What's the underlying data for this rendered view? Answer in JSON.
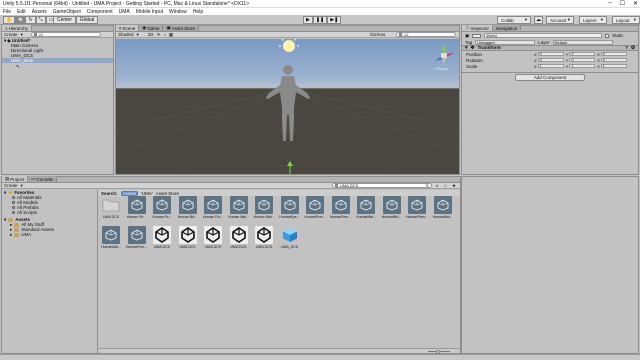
{
  "window": {
    "title": "Unity 5.5.1f1 Personal (64bit) - Untitled - UMA Project - Getting Started - PC, Mac & Linux Standalone* <DX11>",
    "menus": [
      "File",
      "Edit",
      "Assets",
      "GameObject",
      "Component",
      "UMA",
      "Mobile Input",
      "Window",
      "Help"
    ]
  },
  "toolbar": {
    "pivot": "Center",
    "space": "Global",
    "collab": "Collab",
    "account": "Account",
    "layers": "Layers",
    "layout": "Layout"
  },
  "hierarchy": {
    "tab": "Hierarchy",
    "create": "Create",
    "search": "All",
    "scene": "Untitled*",
    "items": [
      "Main Camera",
      "Directional Light",
      "UMA_DCS",
      "UMA_Male"
    ]
  },
  "scene": {
    "tabs": [
      "Scene",
      "Game",
      "Asset Store"
    ],
    "shading": "Shaded",
    "gizmos": "Gizmos",
    "search": "All",
    "persp": "< Persp"
  },
  "inspector": {
    "tabs": [
      "Inspector",
      "Navigation"
    ],
    "object_name": "World",
    "static_label": "Static",
    "tag_label": "Tag",
    "tag_value": "Untagged",
    "layer_label": "Layer",
    "layer_value": "Default",
    "component": "Transform",
    "rows": [
      {
        "label": "Position",
        "x": "0",
        "y": "0",
        "z": "0"
      },
      {
        "label": "Rotation",
        "x": "0",
        "y": "0",
        "z": "0"
      },
      {
        "label": "Scale",
        "x": "1",
        "y": "1",
        "z": "1"
      }
    ],
    "add_component": "Add Component"
  },
  "project": {
    "tabs": [
      "Project",
      "Console"
    ],
    "create": "Create",
    "favorites_title": "Favorites",
    "favorites": [
      "All Materials",
      "All Models",
      "All Prefabs",
      "All Scripts"
    ],
    "assets_title": "Assets",
    "assets_tree": [
      "All My Stuff",
      "Standard Assets",
      "UMA"
    ],
    "search_label": "Search:",
    "search_scopes": [
      "Assets",
      "'UMA'",
      "Asset Store"
    ],
    "search_query": "UMA DCS",
    "assets": [
      {
        "name": "UMA DCS",
        "kind": "folder"
      },
      {
        "name": "Human Fe...",
        "kind": "script"
      },
      {
        "name": "Human Fe...",
        "kind": "script"
      },
      {
        "name": "Human Bri...",
        "kind": "script"
      },
      {
        "name": "Human Ful...",
        "kind": "script"
      },
      {
        "name": "Human Mal...",
        "kind": "script"
      },
      {
        "name": "Human Mal...",
        "kind": "script"
      },
      {
        "name": "HumanEye...",
        "kind": "script"
      },
      {
        "name": "HumanFem...",
        "kind": "script"
      },
      {
        "name": "HumanFem...",
        "kind": "script"
      },
      {
        "name": "HumanMal...",
        "kind": "script"
      },
      {
        "name": "HumanBrit...",
        "kind": "script"
      },
      {
        "name": "HumanFiem...",
        "kind": "script"
      },
      {
        "name": "HumanMal...",
        "kind": "script"
      },
      {
        "name": "HumanMal...",
        "kind": "script"
      },
      {
        "name": "HumanFem...",
        "kind": "script"
      },
      {
        "name": "UMA DCS",
        "kind": "prefab"
      },
      {
        "name": "UMA DCS",
        "kind": "prefab"
      },
      {
        "name": "UMA DCS",
        "kind": "prefab"
      },
      {
        "name": "UMA DCS",
        "kind": "prefab"
      },
      {
        "name": "UMA DCS",
        "kind": "prefab"
      },
      {
        "name": "UMA_DCS",
        "kind": "cube"
      }
    ]
  }
}
